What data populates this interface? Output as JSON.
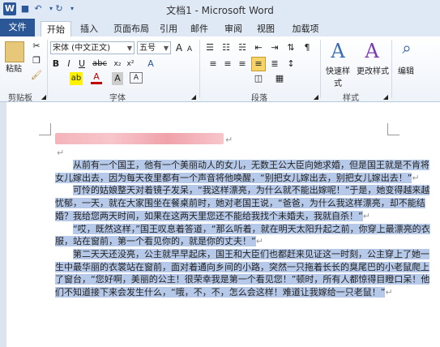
{
  "title": "文档1 - Microsoft Word",
  "tabs": [
    "文件",
    "开始",
    "插入",
    "页面布局",
    "引用",
    "邮件",
    "审阅",
    "视图",
    "加载项"
  ],
  "active_tab": "开始",
  "clipboard": {
    "paste_label": "粘贴",
    "group_label": "剪贴板"
  },
  "font": {
    "name": "宋体 (中文正文)",
    "size": "五号",
    "group_label": "字体",
    "bold": "B",
    "italic": "I",
    "underline": "U",
    "strike": "abc",
    "grow": "A",
    "shrink": "A",
    "font_color": "A",
    "highlight": "ab",
    "char_shading": "A"
  },
  "paragraph": {
    "group_label": "段落"
  },
  "styles": {
    "quick_label": "快速样式",
    "change_label": "更改样式",
    "group_label": "样式"
  },
  "editing": {
    "label": "编辑"
  },
  "document": {
    "paragraphs": [
      "从前有一个国王，他有一个美丽动人的女儿，无数王公大臣向她求婚，但是国王就是不肯将女儿嫁出去，因为每天夜里都有一个声音将他唤醒，“别把女儿嫁出去，别把女儿嫁出去！”",
      "可怜的姑娘整天对着镜子发呆，“我这样漂亮，为什么就不能出嫁呢！”于是，她变得越来越忧郁，一天，就在大家围坐在餐桌前时，她对老国王说，“爸爸，为什么我这样漂亮，却不能结婚？我给您两天时间，如果在这两天里您还不能给我找个未婚夫，我就自杀！”",
      "“哎，既然这样，”国王叹息着答道，“那么听着，就在明天太阳升起之前，你穿上最漂亮的衣服，站在窗前，第一个看见你的，就是你的丈夫！”",
      "第二天天还没亮，公主就早早起床，国王和大臣们也都赶来见证这一时刻，公主穿上了她一生中最华丽的衣裳站在窗前，面对着通向乡间的小路，突然一只拖着长长的臭尾巴的小老鼠爬上了窗台，“您好啊，美丽的公主！很荣幸我是第一个看见您！”顿时，所有人都惊得目瞪口呆！他们不知道接下来会发生什么，“哦，不，不，怎么会这样！难道让我嫁给一只老鼠！”"
    ]
  },
  "marks": {
    "return": "↵"
  }
}
